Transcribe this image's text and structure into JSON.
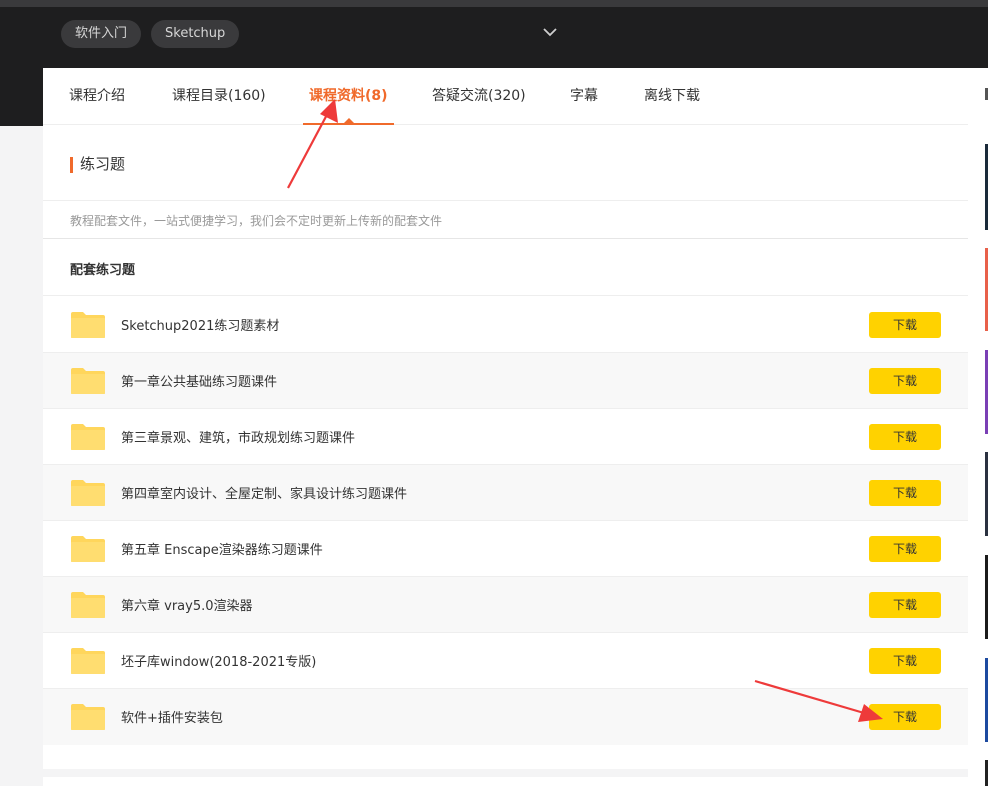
{
  "topbar": {
    "tags": [
      "软件入门",
      "Sketchup"
    ]
  },
  "tabs": [
    {
      "label": "课程介绍",
      "active": false
    },
    {
      "label": "课程目录(160)",
      "active": false
    },
    {
      "label": "课程资料(8)",
      "active": true
    },
    {
      "label": "答疑交流(320)",
      "active": false
    },
    {
      "label": "字幕",
      "active": false
    },
    {
      "label": "离线下载",
      "active": false
    }
  ],
  "section": {
    "title": "练习题",
    "description": "教程配套文件，一站式便捷学习，我们会不定时更新上传新的配套文件",
    "subheading": "配套练习题"
  },
  "files": [
    {
      "name": "Sketchup2021练习题素材",
      "button": "下载"
    },
    {
      "name": "第一章公共基础练习题课件",
      "button": "下载"
    },
    {
      "name": "第三章景观、建筑，市政规划练习题课件",
      "button": "下载"
    },
    {
      "name": "第四章室内设计、全屋定制、家具设计练习题课件",
      "button": "下载"
    },
    {
      "name": "第五章 Enscape渲染器练习题课件",
      "button": "下载"
    },
    {
      "name": "第六章 vray5.0渲染器",
      "button": "下载"
    },
    {
      "name": "坯子库window(2018-2021专版)",
      "button": "下载"
    },
    {
      "name": "软件+插件安装包",
      "button": "下载"
    }
  ],
  "colors": {
    "accent": "#f06a2b",
    "download_button": "#ffd200",
    "folder": "#ffd65c",
    "annotation_arrow": "#ee3a3a"
  },
  "icons": {
    "folder": "folder-icon",
    "chevron": "chevron-down-icon"
  }
}
